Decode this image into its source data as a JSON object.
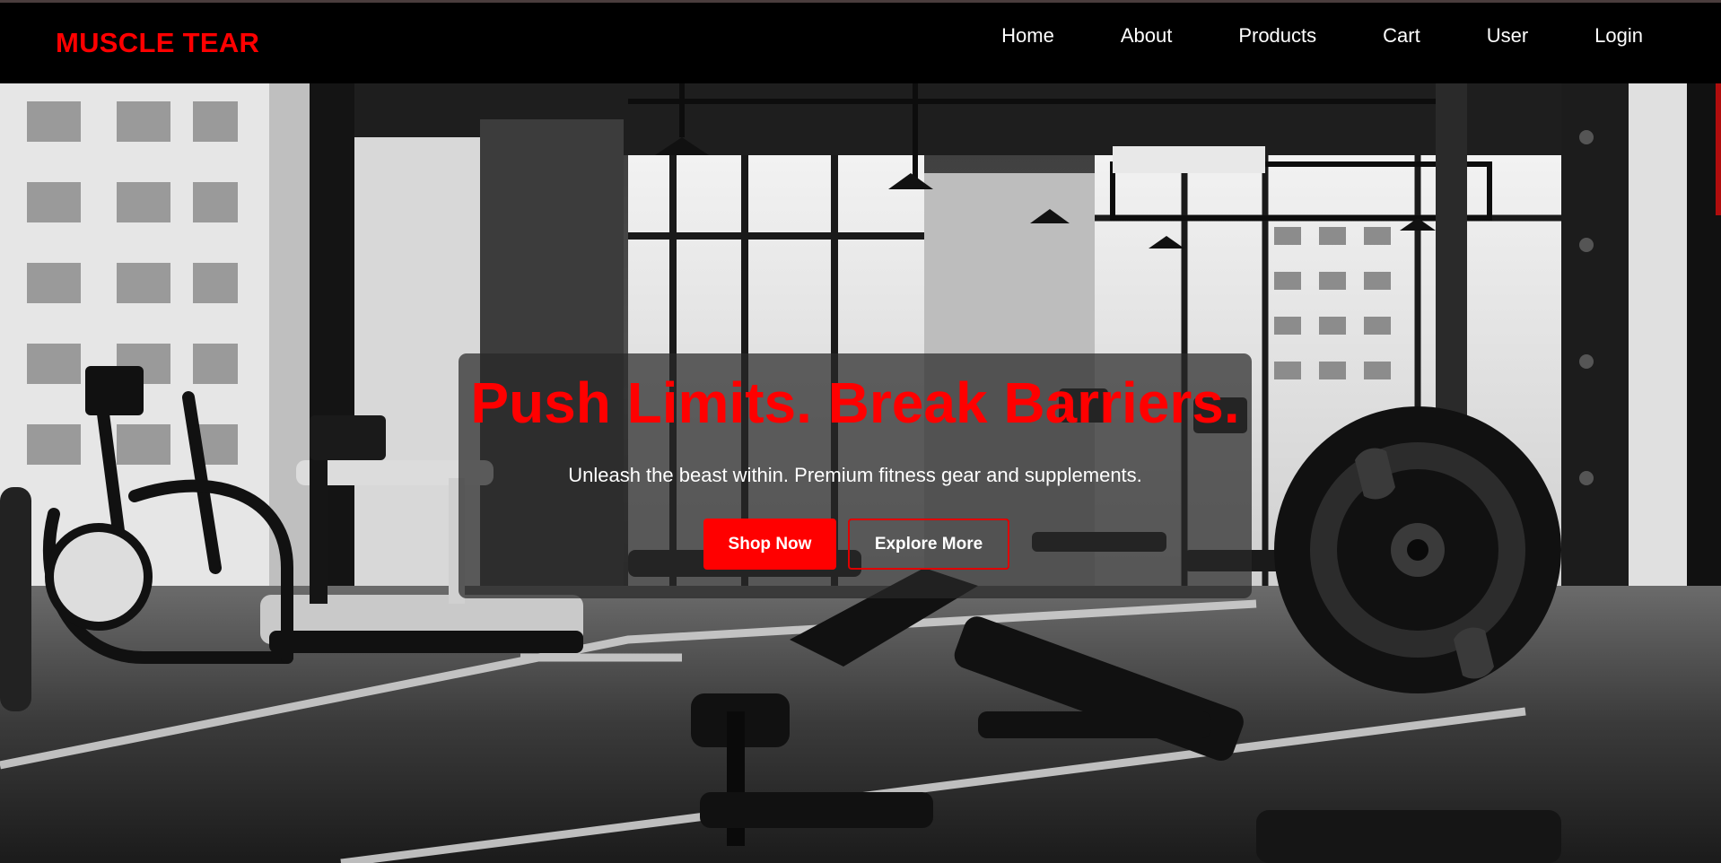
{
  "brand": {
    "name": "MUSCLE TEAR",
    "color": "#ff0000"
  },
  "nav": {
    "items": [
      {
        "label": "Home"
      },
      {
        "label": "About"
      },
      {
        "label": "Products"
      },
      {
        "label": "Cart"
      },
      {
        "label": "User"
      },
      {
        "label": "Login"
      }
    ]
  },
  "hero": {
    "title": "Push Limits. Break Barriers.",
    "subtitle": "Unleash the beast within. Premium fitness gear and supplements.",
    "primary_button": "Shop Now",
    "secondary_button": "Explore More",
    "background": "grayscale-gym-interior-photo",
    "accent_color": "#ff0000"
  }
}
